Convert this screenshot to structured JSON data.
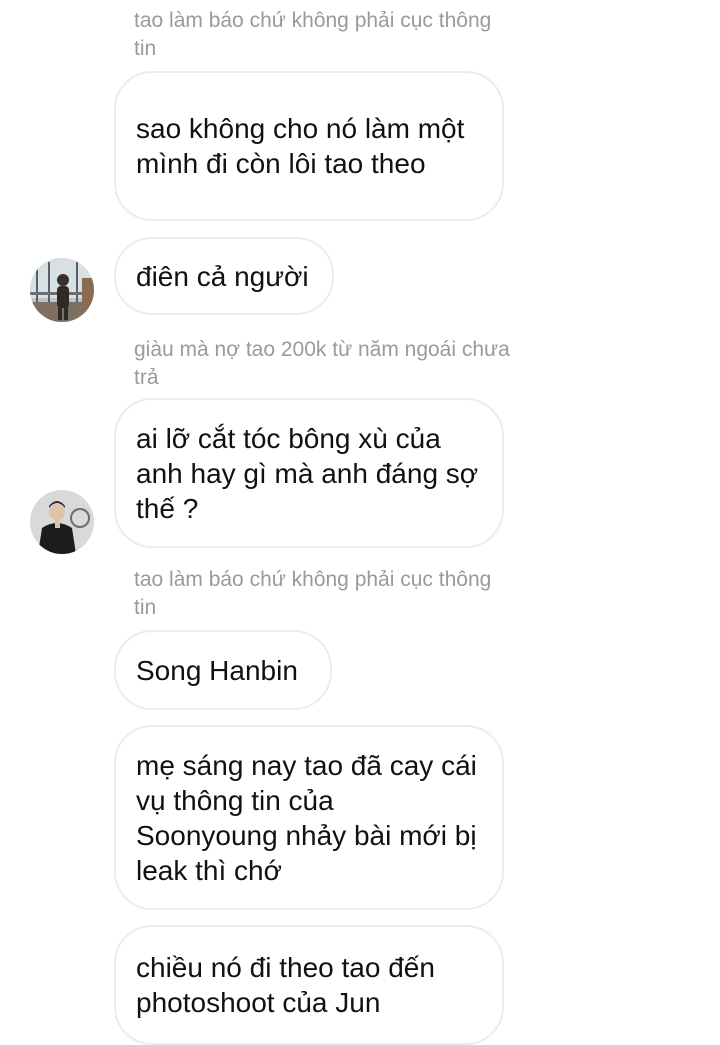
{
  "conversation": {
    "messages": [
      {
        "reply_context": "tao làm báo chứ không phải cục thông tin",
        "text": "sao không cho nó làm một mình đi còn lôi tao theo"
      },
      {
        "text": "điên cả người"
      },
      {
        "reply_context": "giàu mà nợ tao 200k từ năm ngoái chưa trả",
        "text": "ai lỡ cắt tóc bông xù của anh hay gì mà anh đáng sợ thế ?"
      },
      {
        "reply_context": "tao làm báo chứ không phải cục thông tin",
        "text": "Song Hanbin"
      },
      {
        "text": "mẹ sáng nay tao đã cay cái vụ thông tin của Soonyoung nhảy bài mới bị leak thì chớ"
      },
      {
        "text": "chiều nó đi theo tao đến photoshoot của Jun"
      }
    ]
  },
  "avatars": [
    {
      "icon": "profile-photo-window-icon"
    },
    {
      "icon": "profile-photo-dark-jacket-icon"
    }
  ],
  "colors": {
    "bubble_border": "#ececec",
    "meta_text": "#9a9a9a",
    "message_text": "#111111"
  }
}
